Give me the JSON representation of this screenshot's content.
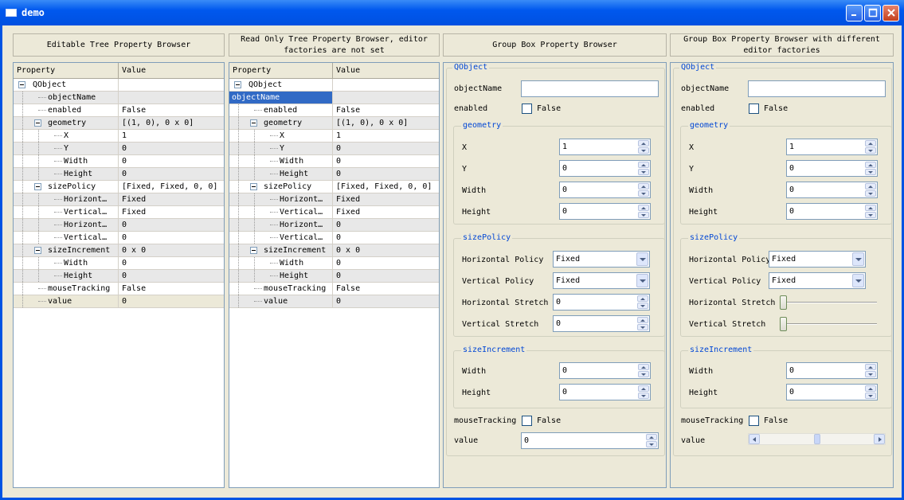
{
  "window": {
    "title": "demo"
  },
  "headers": [
    "Editable Tree Property Browser",
    "Read Only Tree Property Browser, editor factories are not set",
    "Group Box Property Browser",
    "Group Box Property Browser with different editor factories"
  ],
  "tree": {
    "col_property": "Property",
    "col_value": "Value",
    "rows": [
      {
        "label": "QObject",
        "value": ""
      },
      {
        "label": "objectName",
        "value": ""
      },
      {
        "label": "enabled",
        "value": "False"
      },
      {
        "label": "geometry",
        "value": "[(1, 0), 0 x 0]"
      },
      {
        "label": "X",
        "value": "1"
      },
      {
        "label": "Y",
        "value": "0"
      },
      {
        "label": "Width",
        "value": "0"
      },
      {
        "label": "Height",
        "value": "0"
      },
      {
        "label": "sizePolicy",
        "value": "[Fixed, Fixed, 0, 0]"
      },
      {
        "label": "Horizont…",
        "value": "Fixed"
      },
      {
        "label": "Vertical…",
        "value": "Fixed"
      },
      {
        "label": "Horizont…",
        "value": "0"
      },
      {
        "label": "Vertical…",
        "value": "0"
      },
      {
        "label": "sizeIncrement",
        "value": "0 x 0"
      },
      {
        "label": "Width",
        "value": "0"
      },
      {
        "label": "Height",
        "value": "0"
      },
      {
        "label": "mouseTracking",
        "value": "False"
      },
      {
        "label": "value",
        "value": "0"
      }
    ]
  },
  "groupbox": {
    "qobject": "QObject",
    "objectName": "objectName",
    "objectName_value": "",
    "enabled": "enabled",
    "enabled_value": "False",
    "geometry": "geometry",
    "x": "X",
    "x_value": "1",
    "y": "Y",
    "y_value": "0",
    "width": "Width",
    "width_value": "0",
    "height": "Height",
    "height_value": "0",
    "sizePolicy": "sizePolicy",
    "hpolicy": "Horizontal Policy",
    "hpolicy_value": "Fixed",
    "vpolicy": "Vertical Policy",
    "vpolicy_value": "Fixed",
    "hstretch": "Horizontal Stretch",
    "hstretch_value": "0",
    "vstretch": "Vertical Stretch",
    "vstretch_value": "0",
    "sizeIncrement": "sizeIncrement",
    "si_width": "Width",
    "si_width_value": "0",
    "si_height": "Height",
    "si_height_value": "0",
    "mouseTracking": "mouseTracking",
    "mouseTracking_value": "False",
    "value": "value",
    "value_value": "0",
    "stretch_h_level": 0,
    "stretch_v_level": 0,
    "value_scroll_level": 0.5
  },
  "colors": {
    "selection": "#316ac5",
    "groupLabel": "#0046d5",
    "titlebar": "#0058ee"
  }
}
